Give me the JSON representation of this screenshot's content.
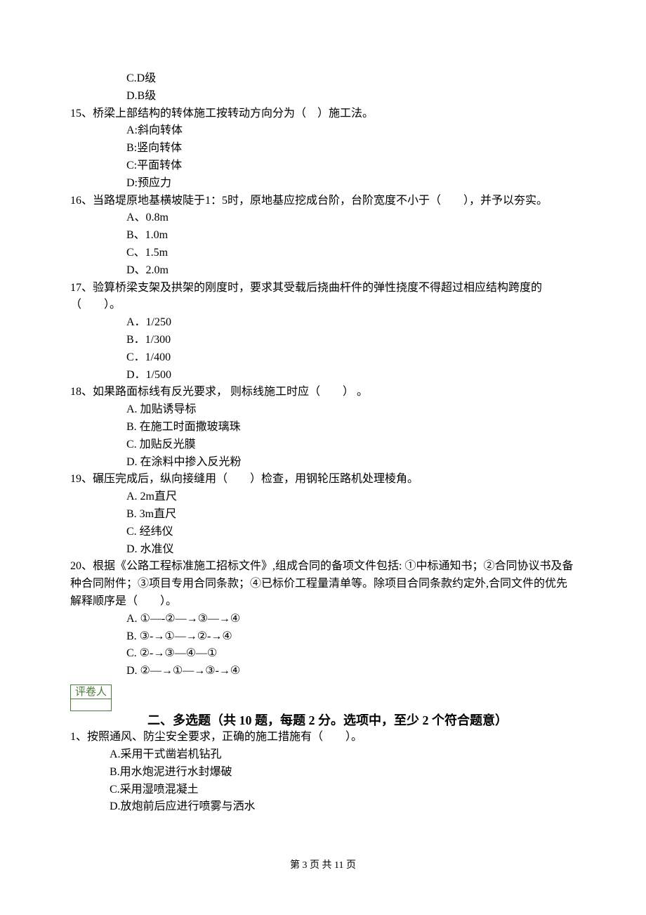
{
  "orphan_options": [
    "C.D级",
    "D.B级"
  ],
  "questions": [
    {
      "num": "15、",
      "text": "桥梁上部结构的转体施工按转动方向分为（　）施工法。",
      "options": [
        "A:斜向转体",
        "B:竖向转体",
        "C:平面转体",
        "D:预应力"
      ],
      "option_class": "option"
    },
    {
      "num": "16、",
      "text": "当路堤原地基横坡陡于1：5时，原地基应挖成台阶，台阶宽度不小于（　　），并予以夯实。",
      "options": [
        "A、0.8m",
        "B、1.0m",
        "C、1.5m",
        "D、2.0m"
      ],
      "option_class": "option"
    },
    {
      "num": "17、",
      "text": "验算桥梁支架及拱架的刚度时，要求其受载后挠曲杆件的弹性挠度不得超过相应结构跨度的（　　）。",
      "options": [
        "A．1/250",
        "B．1/300",
        "C．1/400",
        "D．1/500"
      ],
      "option_class": "option"
    },
    {
      "num": "18、",
      "text": "如果路面标线有反光要求， 则标线施工时应（　　） 。",
      "options": [
        "A. 加贴诱导标",
        "B. 在施工时面撒玻璃珠",
        "C. 加贴反光膜",
        "D. 在涂料中掺入反光粉"
      ],
      "option_class": "option"
    },
    {
      "num": "19、",
      "text": "碾压完成后，纵向接缝用（　　）检查，用钢轮压路机处理棱角。",
      "options": [
        "A. 2m直尺",
        "B. 3m直尺",
        "C. 经纬仪",
        "D. 水准仪"
      ],
      "option_class": "option"
    },
    {
      "num": "20、",
      "text": "根据《公路工程标准施工招标文件》,组成合同的备项文件包括: ①中标通知书；②合同协议书及备种合同附件；③项目专用合同条款；④已标价工程量清单等。除项目合同条款约定外,合同文件的优先解释顺序是（　　）。",
      "options": [
        "A. ①―-②―→③―→④",
        "B. ③-→①―→②-→④",
        "C. ②-→③―④―①",
        "D. ②―→①―→③-→④"
      ],
      "option_class": "option"
    }
  ],
  "grader_label": "评卷人",
  "section_title": "二、多选题（共 10 题，每题 2 分。选项中，至少 2 个符合题意）",
  "mc_questions": [
    {
      "num": "1、",
      "text": "按照通风、防尘安全要求，正确的施工措施有（　　）。",
      "options": [
        "A.采用干式凿岩机钻孔",
        "B.用水炮泥进行水封爆破",
        "C.采用湿喷混凝土",
        "D.放炮前后应进行喷雾与洒水"
      ],
      "option_class": "option-narrow"
    }
  ],
  "footer": "第 3 页 共 11 页"
}
